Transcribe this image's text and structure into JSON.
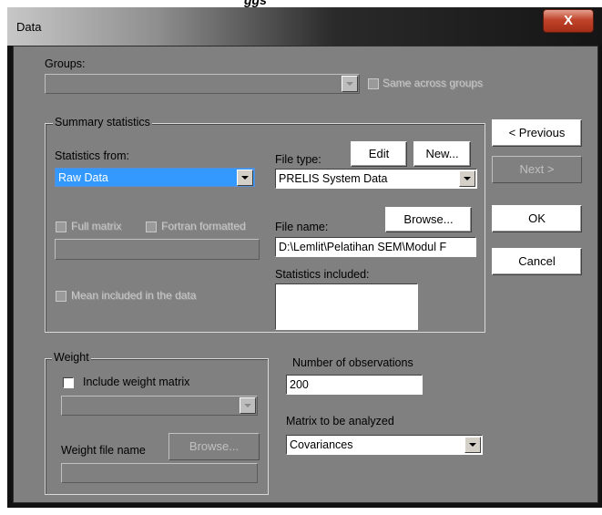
{
  "window": {
    "title": "Data",
    "close_glyph": "X"
  },
  "groups": {
    "label": "Groups:",
    "selected": "",
    "same_across_label": "Same across groups"
  },
  "summary": {
    "title": "Summary statistics",
    "statistics_from_label": "Statistics from:",
    "statistics_from_value": "Raw Data",
    "full_matrix_label": "Full matrix",
    "fortran_formatted_label": "Fortran formatted",
    "mean_included_label": "Mean included in the data",
    "file_type_label": "File type:",
    "edit_label": "Edit",
    "new_label": "New...",
    "file_type_value": "PRELIS System Data",
    "file_name_label": "File name:",
    "browse_label": "Browse...",
    "file_name_value": "D:\\Lemlit\\Pelatihan SEM\\Modul F",
    "statistics_included_label": "Statistics included:"
  },
  "weight": {
    "title": "Weight",
    "include_label": "Include weight matrix",
    "file_name_label": "Weight file name",
    "browse_label": "Browse..."
  },
  "observations": {
    "label": "Number of observations",
    "value": "200"
  },
  "matrix": {
    "label": "Matrix to be analyzed",
    "value": "Covariances"
  },
  "buttons": {
    "previous": "< Previous",
    "next": "Next >",
    "ok": "OK",
    "cancel": "Cancel"
  }
}
